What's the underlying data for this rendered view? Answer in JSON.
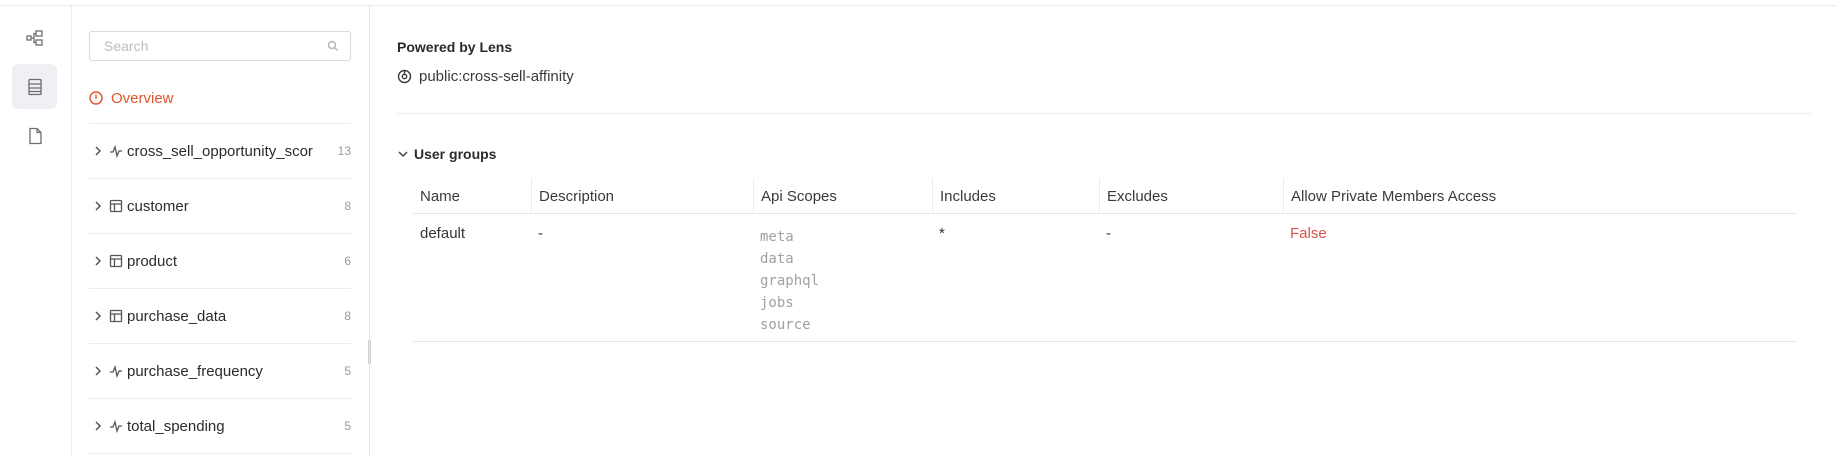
{
  "rail": {
    "icons": [
      "diagram-icon",
      "table-layout-icon",
      "document-icon"
    ]
  },
  "sidebar": {
    "search_placeholder": "Search",
    "overview_label": "Overview",
    "items": [
      {
        "label": "cross_sell_opportunity_scor",
        "count": "13",
        "kind": "view"
      },
      {
        "label": "customer",
        "count": "8",
        "kind": "table"
      },
      {
        "label": "product",
        "count": "6",
        "kind": "table"
      },
      {
        "label": "purchase_data",
        "count": "8",
        "kind": "table"
      },
      {
        "label": "purchase_frequency",
        "count": "5",
        "kind": "view"
      },
      {
        "label": "total_spending",
        "count": "5",
        "kind": "view"
      }
    ]
  },
  "main": {
    "powered_by": "Powered by Lens",
    "lens_name": "public:cross-sell-affinity",
    "section_title": "User groups",
    "columns": [
      "Name",
      "Description",
      "Api Scopes",
      "Includes",
      "Excludes",
      "Allow Private Members Access"
    ],
    "rows": [
      {
        "name": "default",
        "description": "-",
        "api_scopes": [
          "meta",
          "data",
          "graphql",
          "jobs",
          "source"
        ],
        "includes": "*",
        "excludes": "-",
        "allow_private": "False"
      }
    ]
  },
  "colors": {
    "accent": "#e0552b",
    "false_value": "#d9534f"
  }
}
